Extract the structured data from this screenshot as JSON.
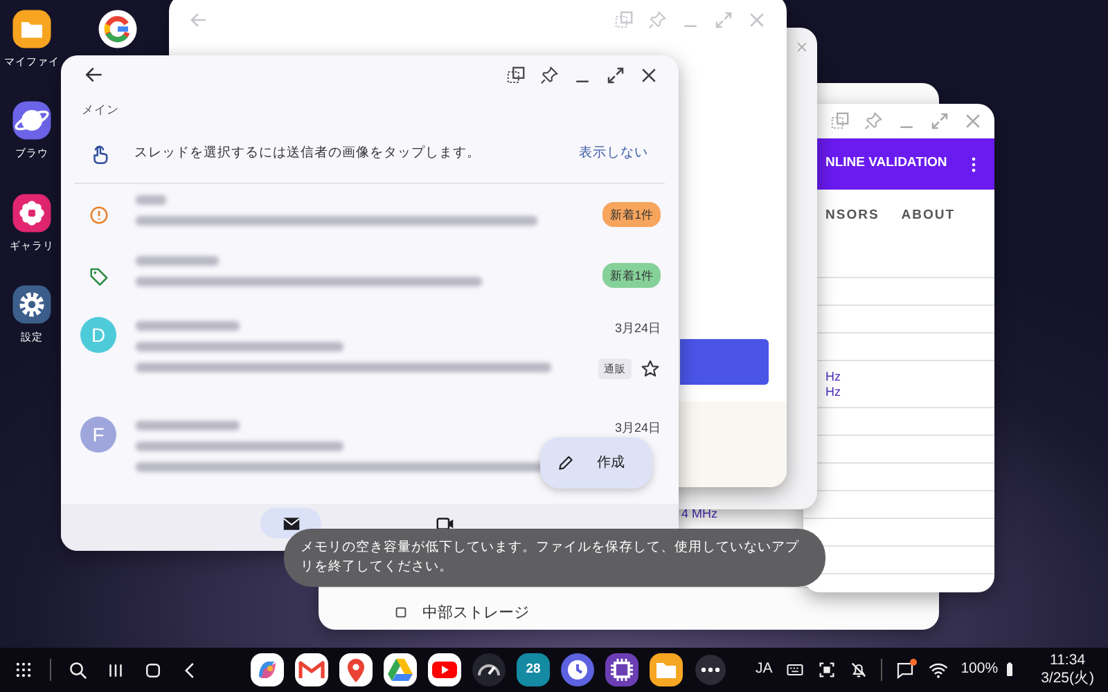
{
  "desktop_icons": [
    {
      "kind": "folder",
      "label": "マイファイ"
    },
    {
      "kind": "google"
    },
    {
      "kind": "browser",
      "label": "ブラウ"
    },
    {
      "kind": "gallery",
      "label": "ギャラリ"
    },
    {
      "kind": "settings",
      "label": "設定"
    }
  ],
  "storage_window": {
    "reading": "4 MHz",
    "item": "中部ストレージ"
  },
  "validation_window": {
    "title": "NLINE VALIDATION",
    "tabs": [
      {
        "label": "NSORS",
        "selected": false
      },
      {
        "label": "ABOUT",
        "selected": false
      }
    ],
    "readings": [
      "Hz",
      "Hz"
    ]
  },
  "mail_window": {
    "section_label": "メイン",
    "tip": {
      "text": "スレッドを選択するには送信者の画像をタップします。",
      "action": "表示しない"
    },
    "threads": [
      {
        "kind": "category",
        "badge": "新着1件",
        "color": "#f7a55d"
      },
      {
        "kind": "category",
        "badge": "新着1件",
        "color": "#86d19a"
      },
      {
        "kind": "person",
        "initial": "D",
        "color": "#4ecbd9",
        "date": "3月24日",
        "label": "通販",
        "starred": false
      },
      {
        "kind": "person",
        "initial": "F",
        "color": "#9ea6dc",
        "date": "3月24日"
      }
    ],
    "compose": "作成",
    "nav": [
      {
        "selected": true
      },
      {
        "selected": false
      }
    ]
  },
  "toast": "メモリの空き容量が低下しています。ファイルを保存して、使用していないアプリを終了してください。",
  "taskbar": {
    "apps": [
      {
        "kind": "copilot"
      },
      {
        "kind": "gmail"
      },
      {
        "kind": "maps"
      },
      {
        "kind": "drive"
      },
      {
        "kind": "youtube"
      },
      {
        "kind": "gauge"
      },
      {
        "kind": "calendar",
        "label": "28"
      },
      {
        "kind": "clock"
      },
      {
        "kind": "chip"
      },
      {
        "kind": "files"
      }
    ],
    "input_method": "JA",
    "notification_dot": true,
    "battery": "100%",
    "time": "11:34",
    "date": "3/25(火)"
  }
}
